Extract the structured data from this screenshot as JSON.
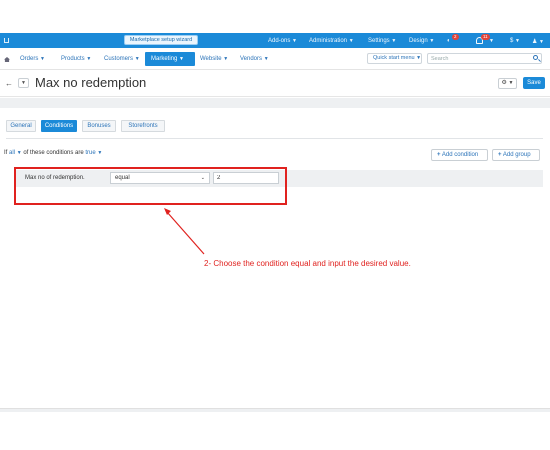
{
  "topbar": {
    "wizard_label": "Marketplace setup wizard",
    "links": [
      "Add-ons",
      "Administration",
      "Settings",
      "Design"
    ],
    "notification_badge": "2",
    "bell_badge": "11",
    "currency": "$"
  },
  "nav": {
    "items": [
      "Orders",
      "Products",
      "Customers",
      "Marketing",
      "Website",
      "Vendors"
    ],
    "active_item": "Marketing",
    "quick_start": "Quick start menu",
    "search_placeholder": "Search"
  },
  "title_bar": {
    "title": "Max no redemption",
    "save_label": "Save"
  },
  "tabs": [
    {
      "label": "General",
      "active": false
    },
    {
      "label": "Conditions",
      "active": true
    },
    {
      "label": "Bonuses",
      "active": false
    },
    {
      "label": "Storefronts",
      "active": false
    }
  ],
  "conditions": {
    "prefix": "If",
    "all": "all",
    "middle": "of these conditions are",
    "state": "true",
    "add_condition": "Add condition",
    "add_group": "Add group",
    "row": {
      "label": "Max no of redemption.",
      "operator": "equal",
      "value": "2"
    }
  },
  "annotation": {
    "text": "2- Choose the condition equal and input the desired value.",
    "color": "#e0221f"
  },
  "colors": {
    "primary": "#1b8ad8",
    "link": "#2c74b9"
  }
}
